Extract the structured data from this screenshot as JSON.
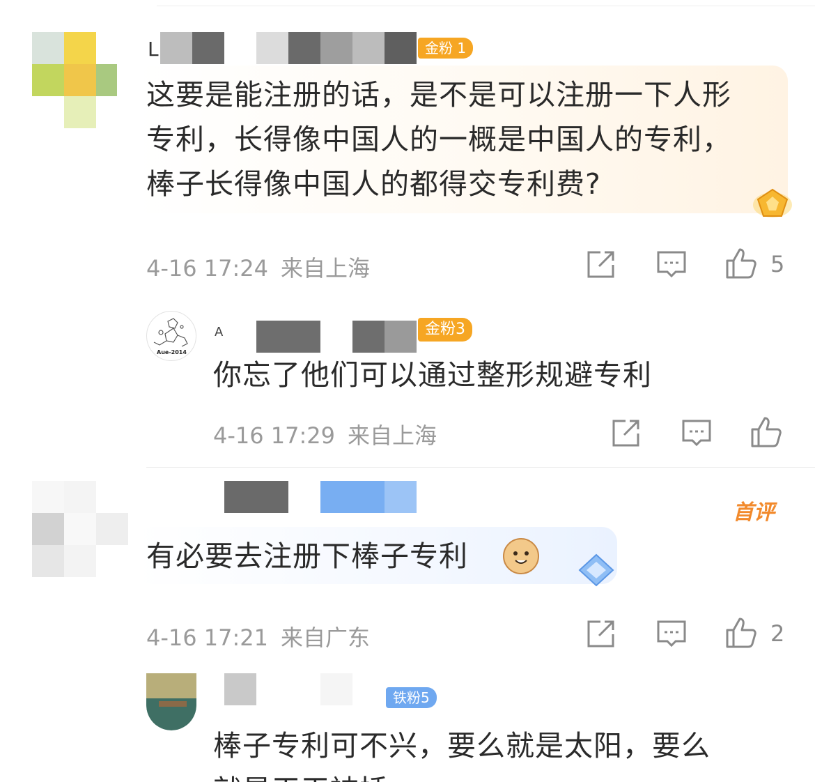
{
  "comments": [
    {
      "username_initial": "L",
      "badge": "金粉 1",
      "text": "这要是能注册的话，是不是可以注册一下人形专利，长得像中国人的一概是中国人的专利，棒子长得像中国人的都得交专利费?",
      "time": "4-16 17:24",
      "location": "来自上海",
      "likes": "5",
      "reply": {
        "username_initial": "A",
        "avatar_caption": "Aue-2014",
        "badge": "金粉3",
        "text": "你忘了他们可以通过整形规避专利",
        "time": "4-16 17:29",
        "location": "来自上海",
        "likes": ""
      }
    },
    {
      "username_initial": "",
      "first_tag": "首评",
      "text": "有必要去注册下棒子专利",
      "time": "4-16 17:21",
      "location": "来自广东",
      "likes": "2",
      "reply": {
        "badge": "铁粉5",
        "text_line1": "棒子专利可不兴，要么就是太阳，要么",
        "text_line2": "就是干干被插"
      }
    }
  ],
  "icons": {
    "share": "share-icon",
    "comment": "comment-icon",
    "like": "thumbs-up-icon"
  },
  "colors": {
    "gold_badge": "#f6a623",
    "iron_badge": "#6fa8f0",
    "meta_gray": "#9a9a9a",
    "first_tag": "#f28a2c"
  }
}
